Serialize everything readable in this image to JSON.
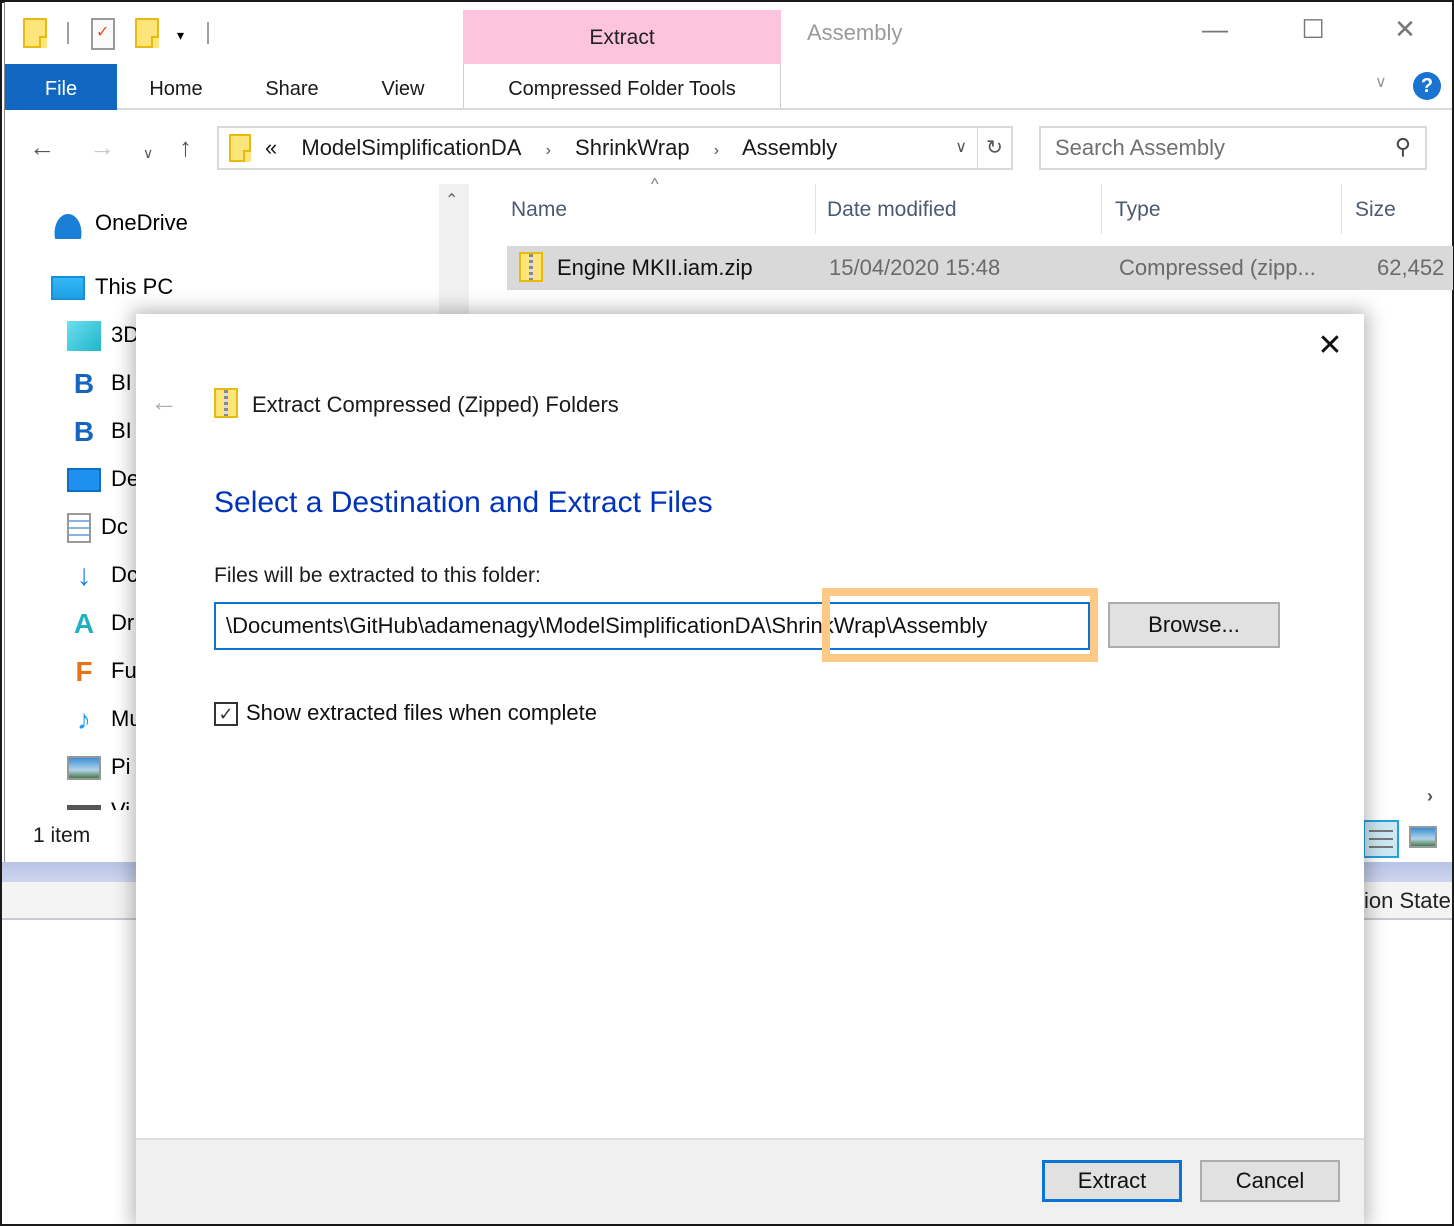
{
  "window": {
    "title": "Assembly",
    "contextual_tab": "Extract",
    "controls": {
      "minimize": "—",
      "maximize": "☐",
      "close": "✕"
    }
  },
  "ribbon": {
    "tabs": [
      {
        "label": "File"
      },
      {
        "label": "Home"
      },
      {
        "label": "Share"
      },
      {
        "label": "View"
      },
      {
        "label": "Compressed Folder Tools"
      }
    ],
    "expand_glyph": "∨",
    "help_glyph": "?"
  },
  "navigation": {
    "back": "←",
    "forward": "→",
    "recent": "∨",
    "up": "↑",
    "breadcrumb_overflow": "«",
    "breadcrumbs": [
      "ModelSimplificationDA",
      "ShrinkWrap",
      "Assembly"
    ],
    "separator": "›",
    "dropdown_glyph": "∨",
    "refresh_glyph": "↻"
  },
  "search": {
    "placeholder": "Search Assembly",
    "icon": "⚲"
  },
  "nav_pane": {
    "items": [
      {
        "label": "OneDrive",
        "icon": "onedrive-icon"
      },
      {
        "label": "This PC",
        "icon": "this-pc-icon"
      },
      {
        "label": "3D",
        "icon": "3d-objects-icon"
      },
      {
        "label": "BI",
        "icon": "bim-icon"
      },
      {
        "label": "BI",
        "icon": "bim-icon"
      },
      {
        "label": "De",
        "icon": "desktop-icon"
      },
      {
        "label": "Dc",
        "icon": "documents-icon"
      },
      {
        "label": "Dc",
        "icon": "downloads-icon"
      },
      {
        "label": "Dr",
        "icon": "autodesk-drive-icon"
      },
      {
        "label": "Fu",
        "icon": "fusion-icon"
      },
      {
        "label": "Mu",
        "icon": "music-icon"
      },
      {
        "label": "Pi",
        "icon": "pictures-icon"
      },
      {
        "label": "Vi",
        "icon": "videos-icon"
      }
    ],
    "scroll_up": "⌃"
  },
  "file_list": {
    "columns": [
      "Name",
      "Date modified",
      "Type",
      "Size"
    ],
    "sort_glyph": "^",
    "rows": [
      {
        "name": "Engine MKII.iam.zip",
        "date_modified": "15/04/2020 15:48",
        "type": "Compressed (zipp...",
        "size": "62,452"
      }
    ]
  },
  "status_bar": {
    "item_count": "1 item",
    "scroll_right": "›"
  },
  "background_app": {
    "column_fragment": "ion State"
  },
  "dialog": {
    "close": "✕",
    "back": "←",
    "title": "Extract Compressed (Zipped) Folders",
    "heading": "Select a Destination and Extract Files",
    "folder_label": "Files will be extracted to this folder:",
    "path_value": "\\Documents\\GitHub\\adamenagy\\ModelSimplificationDA\\ShrinkWrap\\Assembly",
    "browse_label": "Browse...",
    "checkbox_label": "Show extracted files when complete",
    "checkbox_checked": true,
    "checkbox_glyph": "✓",
    "extract_label": "Extract",
    "cancel_label": "Cancel"
  },
  "colors": {
    "file_tab": "#1066c0",
    "contextual_tab": "#fdc4e0",
    "heading_blue": "#0033bb",
    "focus_blue": "#0a74d6",
    "highlight_orange": "#fdc986",
    "selected_row": "#d9d9d9"
  }
}
